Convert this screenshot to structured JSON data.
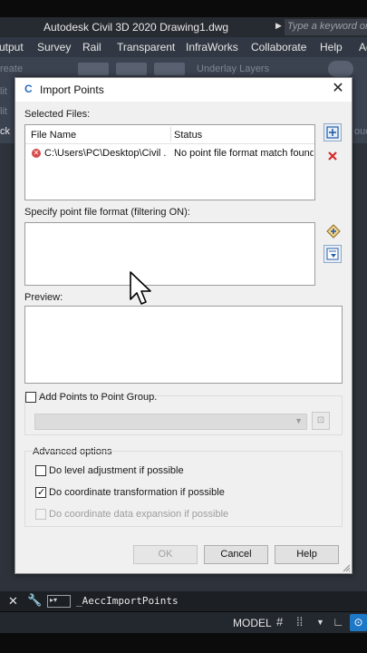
{
  "app": {
    "title": "Autodesk Civil 3D 2020    Drawing1.dwg",
    "search_placeholder": "Type a keyword or p"
  },
  "menubar": [
    "utput",
    "Survey",
    "Rail",
    "Transparent",
    "InfraWorks",
    "Collaborate",
    "Help",
    "Ad"
  ],
  "ribbon": {
    "ghost_left_top": "reate",
    "ghost_left_mid": "lit",
    "ghost_left_low": "lit",
    "ghost_underlay": "Underlay Layers",
    "ghost_left_k": "ck",
    "ghost_right": "ouc"
  },
  "dialog": {
    "title": "Import Points",
    "selected_files_label": "Selected Files:",
    "columns": [
      "File Name",
      "Status"
    ],
    "files": [
      {
        "name": "C:\\Users\\PC\\Desktop\\Civil ...",
        "status": "No point file format match found"
      }
    ],
    "format_label": "Specify point file format (filtering ON):",
    "preview_label": "Preview:",
    "add_to_group": {
      "label": "Add Points to Point Group.",
      "checked": false
    },
    "advanced_label": "Advanced options",
    "options": [
      {
        "label": "Do level adjustment if possible",
        "checked": false,
        "enabled": true
      },
      {
        "label": "Do coordinate transformation if possible",
        "checked": true,
        "enabled": true
      },
      {
        "label": "Do coordinate data expansion if possible",
        "checked": false,
        "enabled": false
      }
    ],
    "buttons": {
      "ok": "OK",
      "cancel": "Cancel",
      "help": "Help"
    }
  },
  "cmdline": {
    "close_glyph": "✕",
    "command": "_AeccImportPoints"
  },
  "statusbar": {
    "model": "MODEL"
  },
  "colors": {
    "dialog_bg": "#f0f0f0",
    "ribbon_bg": "#3b4250",
    "titlebar_bg": "#262a31",
    "error_red": "#d44a4a",
    "accent_blue": "#1e78c8"
  }
}
